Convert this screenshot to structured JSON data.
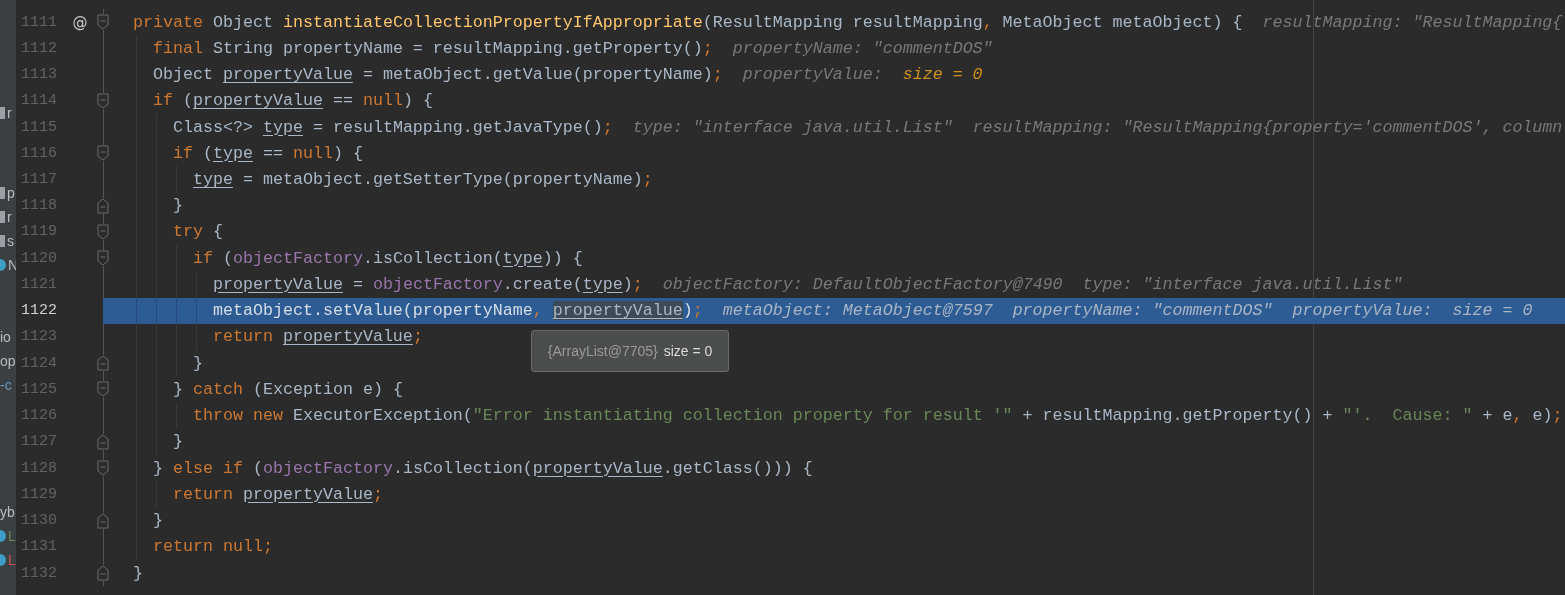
{
  "project_tree": [
    [
      {
        "text": "r",
        "kind": "file",
        "color": "#bbbbbb"
      }
    ],
    [
      {
        "text": "p",
        "kind": "file",
        "color": "#bbbbbb"
      },
      {
        "text": "r",
        "kind": "file",
        "color": "#bbbbbb"
      },
      {
        "text": "s",
        "kind": "file",
        "color": "#bbbbbb"
      },
      {
        "text": "N",
        "kind": "class",
        "color": "#bbbbbb"
      }
    ],
    [
      {
        "text": "io",
        "kind": "text",
        "color": "#bbbbbb"
      },
      {
        "text": "op",
        "kind": "text",
        "color": "#bbbbbb"
      },
      {
        "text": "-c",
        "kind": "text",
        "color": "#6897bb"
      }
    ],
    [
      {
        "text": "yb",
        "kind": "text",
        "color": "#bbbbbb"
      },
      {
        "text": "L",
        "kind": "class",
        "color": "#6a8759"
      },
      {
        "text": "L",
        "kind": "class",
        "color": "#c75450"
      }
    ]
  ],
  "editor": {
    "lines": [
      {
        "number": "1111",
        "marker": "@",
        "kind": "block-start",
        "code": [
          {
            "text": "private",
            "kind": "keyword"
          },
          {
            "text": " Object ",
            "kind": "plain"
          },
          {
            "text": "instantiateCollectionPropertyIfAppropriate",
            "kind": "declaration"
          },
          {
            "text": "(ResultMapping resultMapping",
            "kind": "plain"
          },
          {
            "text": ",",
            "kind": "keyword"
          },
          {
            "text": " MetaObject metaObject) {",
            "kind": "plain"
          }
        ],
        "hints": [
          {
            "text": "resultMapping: \"ResultMapping{"
          }
        ]
      },
      {
        "number": "1112",
        "code": [
          {
            "text": "  final",
            "kind": "keyword"
          },
          {
            "text": " String propertyName = resultMapping.getProperty()",
            "kind": "plain"
          },
          {
            "text": ";",
            "kind": "keyword"
          }
        ],
        "hints": [
          {
            "text": "propertyName: \"commentDOS\""
          }
        ]
      },
      {
        "number": "1113",
        "code": [
          {
            "text": "  Object ",
            "kind": "plain"
          },
          {
            "text": "propertyValue",
            "kind": "local"
          },
          {
            "text": " = metaObject.getValue(propertyName)",
            "kind": "plain"
          },
          {
            "text": ";",
            "kind": "keyword"
          }
        ],
        "hints": [
          {
            "text": "propertyValue:",
            "value": "size = 0"
          }
        ]
      },
      {
        "number": "1114",
        "kind": "block-start",
        "code": [
          {
            "text": "  if",
            "kind": "keyword"
          },
          {
            "text": " (",
            "kind": "plain"
          },
          {
            "text": "propertyValue",
            "kind": "local"
          },
          {
            "text": " == ",
            "kind": "plain"
          },
          {
            "text": "null",
            "kind": "keyword"
          },
          {
            "text": ") {",
            "kind": "plain"
          }
        ]
      },
      {
        "number": "1115",
        "code": [
          {
            "text": "    Class<?> ",
            "kind": "plain"
          },
          {
            "text": "type",
            "kind": "local"
          },
          {
            "text": " = resultMapping.getJavaType()",
            "kind": "plain"
          },
          {
            "text": ";",
            "kind": "keyword"
          }
        ],
        "hints": [
          {
            "text": "type: \"interface java.util.List\""
          },
          {
            "text": "resultMapping: \"ResultMapping{property='commentDOS', column"
          }
        ]
      },
      {
        "number": "1116",
        "kind": "block-start",
        "code": [
          {
            "text": "    if",
            "kind": "keyword"
          },
          {
            "text": " (",
            "kind": "plain"
          },
          {
            "text": "type",
            "kind": "local"
          },
          {
            "text": " == ",
            "kind": "plain"
          },
          {
            "text": "null",
            "kind": "keyword"
          },
          {
            "text": ") {",
            "kind": "plain"
          }
        ]
      },
      {
        "number": "1117",
        "code": [
          {
            "text": "      type",
            "kind": "local"
          },
          {
            "text": " = metaObject.getSetterType(propertyName)",
            "kind": "plain"
          },
          {
            "text": ";",
            "kind": "keyword"
          }
        ]
      },
      {
        "number": "1118",
        "kind": "block-end",
        "code": [
          {
            "text": "    }",
            "kind": "plain"
          }
        ]
      },
      {
        "number": "1119",
        "kind": "block-start",
        "code": [
          {
            "text": "    try",
            "kind": "keyword"
          },
          {
            "text": " {",
            "kind": "plain"
          }
        ]
      },
      {
        "number": "1120",
        "kind": "block-start",
        "code": [
          {
            "text": "      if",
            "kind": "keyword"
          },
          {
            "text": " (",
            "kind": "plain"
          },
          {
            "text": "objectFactory",
            "kind": "field"
          },
          {
            "text": ".isCollection(",
            "kind": "plain"
          },
          {
            "text": "type",
            "kind": "local"
          },
          {
            "text": ")) {",
            "kind": "plain"
          }
        ]
      },
      {
        "number": "1121",
        "code": [
          {
            "text": "        propertyValue",
            "kind": "local"
          },
          {
            "text": " = ",
            "kind": "plain"
          },
          {
            "text": "objectFactory",
            "kind": "field"
          },
          {
            "text": ".create(",
            "kind": "plain"
          },
          {
            "text": "type",
            "kind": "local"
          },
          {
            "text": ")",
            "kind": "plain"
          },
          {
            "text": ";",
            "kind": "keyword"
          }
        ],
        "hints": [
          {
            "text": "objectFactory: DefaultObjectFactory@7490"
          },
          {
            "text": "type: \"interface java.util.List\""
          }
        ]
      },
      {
        "number": "1122",
        "current": true,
        "code": [
          {
            "text": "        metaObject.setValue(propertyName",
            "kind": "plain"
          },
          {
            "text": ", ",
            "kind": "keyword"
          },
          {
            "text": "propertyValue",
            "kind": "local",
            "hovered": true
          },
          {
            "text": ")",
            "kind": "plain"
          },
          {
            "text": ";",
            "kind": "keyword"
          }
        ],
        "hints": [
          {
            "text": "metaObject: MetaObject@7597"
          },
          {
            "text": "propertyName: \"commentDOS\""
          },
          {
            "text": "propertyValue:",
            "value": "size = 0"
          }
        ],
        "tooltip": {
          "object": "{ArrayList@7705}",
          "value": "size = 0"
        }
      },
      {
        "number": "1123",
        "code": [
          {
            "text": "        return ",
            "kind": "keyword"
          },
          {
            "text": "propertyValue",
            "kind": "local"
          },
          {
            "text": ";",
            "kind": "keyword"
          }
        ]
      },
      {
        "number": "1124",
        "kind": "block-end",
        "code": [
          {
            "text": "      }",
            "kind": "plain"
          }
        ]
      },
      {
        "number": "1125",
        "kind": "block-start",
        "code": [
          {
            "text": "    } ",
            "kind": "plain"
          },
          {
            "text": "catch",
            "kind": "keyword"
          },
          {
            "text": " (Exception e) {",
            "kind": "plain"
          }
        ]
      },
      {
        "number": "1126",
        "code": [
          {
            "text": "      throw new",
            "kind": "keyword"
          },
          {
            "text": " ExecutorException(",
            "kind": "plain"
          },
          {
            "text": "\"Error instantiating collection property for result '\"",
            "kind": "string"
          },
          {
            "text": " + resultMapping.getProperty() + ",
            "kind": "plain"
          },
          {
            "text": "\"'.  Cause: \"",
            "kind": "string"
          },
          {
            "text": " + e",
            "kind": "plain"
          },
          {
            "text": ",",
            "kind": "keyword"
          },
          {
            "text": " e)",
            "kind": "plain"
          },
          {
            "text": ";",
            "kind": "keyword"
          }
        ]
      },
      {
        "number": "1127",
        "kind": "block-end",
        "code": [
          {
            "text": "    }",
            "kind": "plain"
          }
        ]
      },
      {
        "number": "1128",
        "kind": "block-start",
        "code": [
          {
            "text": "  } ",
            "kind": "plain"
          },
          {
            "text": "else if",
            "kind": "keyword"
          },
          {
            "text": " (",
            "kind": "plain"
          },
          {
            "text": "objectFactory",
            "kind": "field"
          },
          {
            "text": ".isCollection(",
            "kind": "plain"
          },
          {
            "text": "propertyValue",
            "kind": "local"
          },
          {
            "text": ".getClass())) {",
            "kind": "plain"
          }
        ]
      },
      {
        "number": "1129",
        "code": [
          {
            "text": "    return ",
            "kind": "keyword"
          },
          {
            "text": "propertyValue",
            "kind": "local"
          },
          {
            "text": ";",
            "kind": "keyword"
          }
        ]
      },
      {
        "number": "1130",
        "kind": "block-end",
        "code": [
          {
            "text": "  }",
            "kind": "plain"
          }
        ]
      },
      {
        "number": "1131",
        "code": [
          {
            "text": "  return null;",
            "kind": "keyword"
          }
        ]
      },
      {
        "number": "1132",
        "kind": "block-end",
        "code": [
          {
            "text": "}",
            "kind": "plain"
          }
        ]
      }
    ]
  }
}
